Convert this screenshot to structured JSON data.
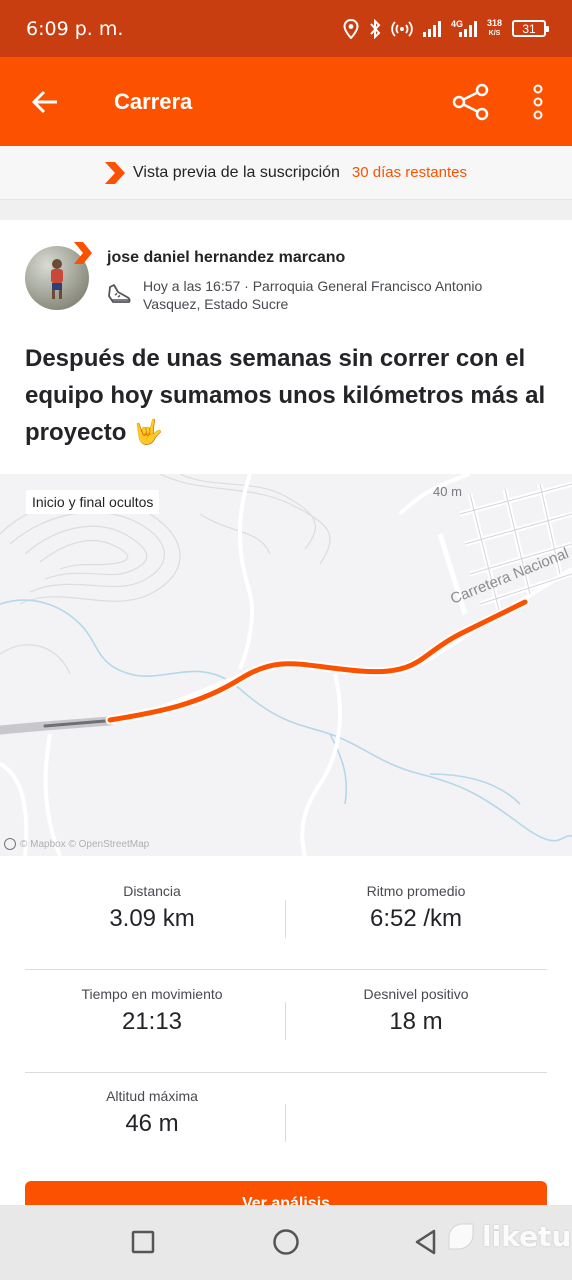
{
  "status_bar": {
    "time": "6:09 p. m.",
    "network_speed_value": "318",
    "network_speed_unit": "K/S",
    "network_type": "4G",
    "battery": "31",
    "icons": [
      "location-icon",
      "bluetooth-icon",
      "hotspot-icon",
      "signal-icon",
      "signal-4g-icon",
      "battery-icon"
    ]
  },
  "app_bar": {
    "title": "Carrera",
    "icons": [
      "back-arrow-icon",
      "share-icon",
      "more-vertical-icon"
    ]
  },
  "subscription_banner": {
    "text": "Vista previa de la suscripción",
    "days_remaining": "30 días restantes",
    "icon": "strava-chevron-icon"
  },
  "activity": {
    "athlete_name": "jose daniel hernandez marcano",
    "meta": "Hoy a las 16:57 · Parroquia General Francisco Antonio Vasquez, Estado Sucre",
    "sport_icon": "running-shoe-icon",
    "title": "Después de unas semanas sin correr con el equipo hoy sumamos unos kilómetros más al proyecto 🤟"
  },
  "map": {
    "privacy_label": "Inicio y final ocultos",
    "elevation_label": "40 m",
    "road_label": "Carretera Nacional",
    "attribution": "© Mapbox © OpenStreetMap"
  },
  "stats": [
    {
      "label": "Distancia",
      "value": "3.09 km"
    },
    {
      "label": "Ritmo promedio",
      "value": "6:52 /km"
    },
    {
      "label": "Tiempo en movimiento",
      "value": "21:13"
    },
    {
      "label": "Desnivel positivo",
      "value": "18 m"
    },
    {
      "label": "Altitud máxima",
      "value": "46 m"
    }
  ],
  "cta": {
    "label": "Ver análisis"
  },
  "nav_bar": {
    "icons": [
      "recents-square-icon",
      "home-circle-icon",
      "back-triangle-icon"
    ]
  },
  "watermark": {
    "text": "liketu"
  },
  "colors": {
    "accent": "#fc5200",
    "status_bar": "#c93e10",
    "text": "#242428"
  }
}
